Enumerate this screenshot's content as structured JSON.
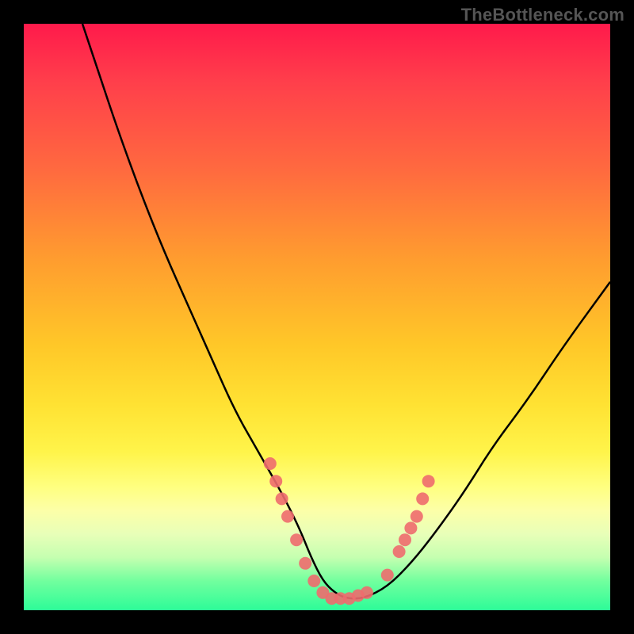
{
  "watermark": "TheBottleneck.com",
  "chart_data": {
    "type": "line",
    "title": "",
    "xlabel": "",
    "ylabel": "",
    "xlim": [
      0,
      100
    ],
    "ylim": [
      0,
      100
    ],
    "series": [
      {
        "name": "curve",
        "x": [
          10,
          13,
          16,
          20,
          24,
          28,
          32,
          36,
          40,
          44,
          47,
          49,
          51,
          53,
          55,
          58,
          62,
          66,
          70,
          75,
          80,
          86,
          92,
          100
        ],
        "y": [
          100,
          91,
          82,
          71,
          61,
          52,
          43,
          34,
          27,
          20,
          14,
          9,
          5,
          3,
          2,
          2,
          4,
          8,
          13,
          20,
          28,
          36,
          45,
          56
        ]
      }
    ],
    "markers": [
      {
        "name": "left-cluster",
        "points": [
          {
            "x": 42,
            "y": 25
          },
          {
            "x": 43,
            "y": 22
          },
          {
            "x": 44,
            "y": 19
          },
          {
            "x": 45,
            "y": 16
          },
          {
            "x": 46.5,
            "y": 12
          },
          {
            "x": 48,
            "y": 8
          },
          {
            "x": 49.5,
            "y": 5
          },
          {
            "x": 51,
            "y": 3
          },
          {
            "x": 52.5,
            "y": 2
          },
          {
            "x": 54,
            "y": 2
          },
          {
            "x": 55.5,
            "y": 2
          },
          {
            "x": 57,
            "y": 2.5
          },
          {
            "x": 58.5,
            "y": 3
          }
        ]
      },
      {
        "name": "right-cluster",
        "points": [
          {
            "x": 62,
            "y": 6
          },
          {
            "x": 64,
            "y": 10
          },
          {
            "x": 65,
            "y": 12
          },
          {
            "x": 66,
            "y": 14
          },
          {
            "x": 67,
            "y": 16
          },
          {
            "x": 68,
            "y": 19
          },
          {
            "x": 69,
            "y": 22
          }
        ]
      }
    ],
    "marker_color": "#ee6b6e",
    "curve_color": "#000000"
  }
}
